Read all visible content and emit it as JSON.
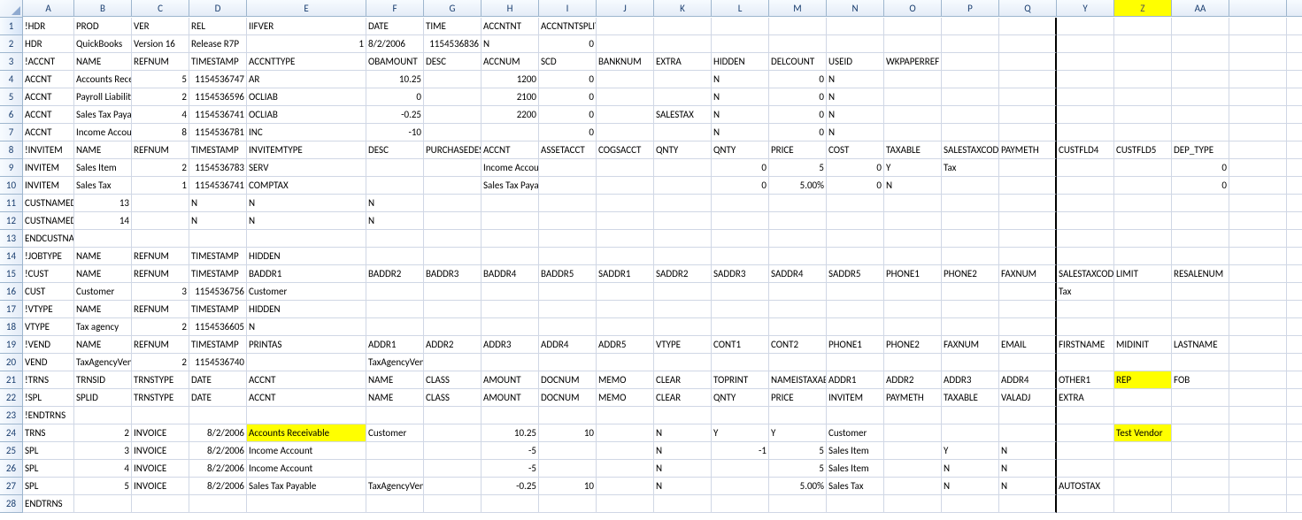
{
  "columns": [
    "",
    "A",
    "B",
    "C",
    "D",
    "E",
    "F",
    "G",
    "H",
    "I",
    "J",
    "K",
    "L",
    "M",
    "N",
    "O",
    "P",
    "Q",
    "Y",
    "Z",
    "AA"
  ],
  "highlight_col_index": 19,
  "thicksep_col_index": 17,
  "rows": [
    {
      "n": 1,
      "cells": [
        "!HDR",
        "PROD",
        "VER",
        "REL",
        "IIFVER",
        "DATE",
        "TIME",
        "ACCNTNT",
        "ACCNTNTSPLITTIME",
        "",
        "",
        "",
        "",
        "",
        "",
        "",
        "",
        "",
        "",
        ""
      ]
    },
    {
      "n": 2,
      "cells": [
        "HDR",
        "QuickBooks",
        "Version 16",
        "Release R7P",
        "1",
        "8/2/2006",
        "1154536836",
        "N",
        "0",
        "",
        "",
        "",
        "",
        "",
        "",
        "",
        "",
        "",
        "",
        ""
      ],
      "num": [
        4,
        6,
        8
      ]
    },
    {
      "n": 3,
      "cells": [
        "!ACCNT",
        "NAME",
        "REFNUM",
        "TIMESTAMP",
        "ACCNTTYPE",
        "OBAMOUNT",
        "DESC",
        "ACCNUM",
        "SCD",
        "BANKNUM",
        "EXTRA",
        "HIDDEN",
        "DELCOUNT",
        "USEID",
        "WKPAPERREF",
        "",
        "",
        "",
        "",
        ""
      ]
    },
    {
      "n": 4,
      "cells": [
        "ACCNT",
        "Accounts Receivable",
        "5",
        "1154536747",
        "AR",
        "10.25",
        "",
        "1200",
        "0",
        "",
        "",
        "N",
        "0",
        "N",
        "",
        "",
        "",
        "",
        "",
        ""
      ],
      "num": [
        2,
        3,
        5,
        7,
        8,
        12
      ]
    },
    {
      "n": 5,
      "cells": [
        "ACCNT",
        "Payroll Liabilities",
        "2",
        "1154536596",
        "OCLIAB",
        "0",
        "",
        "2100",
        "0",
        "",
        "",
        "N",
        "0",
        "N",
        "",
        "",
        "",
        "",
        "",
        ""
      ],
      "num": [
        2,
        3,
        5,
        7,
        8,
        12
      ]
    },
    {
      "n": 6,
      "cells": [
        "ACCNT",
        "Sales Tax Payable",
        "4",
        "1154536741",
        "OCLIAB",
        "-0.25",
        "",
        "2200",
        "0",
        "",
        "SALESTAX",
        "N",
        "0",
        "N",
        "",
        "",
        "",
        "",
        "",
        ""
      ],
      "num": [
        2,
        3,
        5,
        7,
        8,
        12
      ]
    },
    {
      "n": 7,
      "cells": [
        "ACCNT",
        "Income Account",
        "8",
        "1154536781",
        "INC",
        "-10",
        "",
        "",
        "0",
        "",
        "",
        "N",
        "0",
        "N",
        "",
        "",
        "",
        "",
        "",
        ""
      ],
      "num": [
        2,
        3,
        5,
        8,
        12
      ]
    },
    {
      "n": 8,
      "cells": [
        "!INVITEM",
        "NAME",
        "REFNUM",
        "TIMESTAMP",
        "INVITEMTYPE",
        "DESC",
        "PURCHASEDESC",
        "ACCNT",
        "ASSETACCT",
        "COGSACCT",
        "QNTY",
        "QNTY",
        "PRICE",
        "COST",
        "TAXABLE",
        "SALESTAXCODE",
        "PAYMETH",
        "CUSTFLD4",
        "CUSTFLD5",
        "DEP_TYPE"
      ]
    },
    {
      "n": 9,
      "cells": [
        "INVITEM",
        "Sales Item",
        "2",
        "1154536783",
        "SERV",
        "",
        "",
        "Income Account",
        "",
        "",
        "",
        "0",
        "5",
        "0",
        "Y",
        "Tax",
        "",
        "",
        "",
        "0"
      ],
      "num": [
        2,
        3,
        11,
        12,
        13,
        19
      ]
    },
    {
      "n": 10,
      "cells": [
        "INVITEM",
        "Sales Tax",
        "1",
        "1154536741",
        "COMPTAX",
        "",
        "",
        "Sales Tax Payable",
        "",
        "",
        "",
        "0",
        "5.00%",
        "0",
        "N",
        "",
        "",
        "",
        "",
        "0"
      ],
      "num": [
        2,
        3,
        11,
        12,
        13,
        19
      ]
    },
    {
      "n": 11,
      "cells": [
        "CUSTNAMEDICT",
        "13",
        "",
        "N",
        "N",
        "N",
        "",
        "",
        "",
        "",
        "",
        "",
        "",
        "",
        "",
        "",
        "",
        "",
        "",
        ""
      ],
      "num": [
        1
      ]
    },
    {
      "n": 12,
      "cells": [
        "CUSTNAMEDICT",
        "14",
        "",
        "N",
        "N",
        "N",
        "",
        "",
        "",
        "",
        "",
        "",
        "",
        "",
        "",
        "",
        "",
        "",
        "",
        ""
      ],
      "num": [
        1
      ]
    },
    {
      "n": 13,
      "cells": [
        "ENDCUSTNAMEDICT",
        "",
        "",
        "",
        "",
        "",
        "",
        "",
        "",
        "",
        "",
        "",
        "",
        "",
        "",
        "",
        "",
        "",
        "",
        ""
      ]
    },
    {
      "n": 14,
      "cells": [
        "!JOBTYPE",
        "NAME",
        "REFNUM",
        "TIMESTAMP",
        "HIDDEN",
        "",
        "",
        "",
        "",
        "",
        "",
        "",
        "",
        "",
        "",
        "",
        "",
        "",
        "",
        ""
      ]
    },
    {
      "n": 15,
      "cells": [
        "!CUST",
        "NAME",
        "REFNUM",
        "TIMESTAMP",
        "BADDR1",
        "BADDR2",
        "BADDR3",
        "BADDR4",
        "BADDR5",
        "SADDR1",
        "SADDR2",
        "SADDR3",
        "SADDR4",
        "SADDR5",
        "PHONE1",
        "PHONE2",
        "FAXNUM",
        "SALESTAXCODE",
        "LIMIT",
        "RESALENUM"
      ]
    },
    {
      "n": 16,
      "cells": [
        "CUST",
        "Customer",
        "3",
        "1154536756",
        "Customer",
        "",
        "",
        "",
        "",
        "",
        "",
        "",
        "",
        "",
        "",
        "",
        "",
        "Tax",
        "",
        ""
      ],
      "num": [
        2,
        3
      ]
    },
    {
      "n": 17,
      "cells": [
        "!VTYPE",
        "NAME",
        "REFNUM",
        "TIMESTAMP",
        "HIDDEN",
        "",
        "",
        "",
        "",
        "",
        "",
        "",
        "",
        "",
        "",
        "",
        "",
        "",
        "",
        ""
      ]
    },
    {
      "n": 18,
      "cells": [
        "VTYPE",
        "Tax agency",
        "2",
        "1154536605",
        "N",
        "",
        "",
        "",
        "",
        "",
        "",
        "",
        "",
        "",
        "",
        "",
        "",
        "",
        "",
        ""
      ],
      "num": [
        2,
        3
      ]
    },
    {
      "n": 19,
      "cells": [
        "!VEND",
        "NAME",
        "REFNUM",
        "TIMESTAMP",
        "PRINTAS",
        "ADDR1",
        "ADDR2",
        "ADDR3",
        "ADDR4",
        "ADDR5",
        "VTYPE",
        "CONT1",
        "CONT2",
        "PHONE1",
        "PHONE2",
        "FAXNUM",
        "EMAIL",
        "FIRSTNAME",
        "MIDINIT",
        "LASTNAME"
      ]
    },
    {
      "n": 20,
      "cells": [
        "VEND",
        "TaxAgencyVendor",
        "2",
        "1154536740",
        "",
        "TaxAgencyVendor",
        "",
        "",
        "",
        "",
        "",
        "",
        "",
        "",
        "",
        "",
        "",
        "",
        "",
        ""
      ],
      "num": [
        2,
        3
      ]
    },
    {
      "n": 21,
      "cells": [
        "!TRNS",
        "TRNSID",
        "TRNSTYPE",
        "DATE",
        "ACCNT",
        "NAME",
        "CLASS",
        "AMOUNT",
        "DOCNUM",
        "MEMO",
        "CLEAR",
        "TOPRINT",
        "NAMEISTAXABLE",
        "ADDR1",
        "ADDR2",
        "ADDR3",
        "ADDR4",
        "OTHER1",
        "REP",
        "FOB"
      ],
      "hl": [
        18
      ]
    },
    {
      "n": 22,
      "cells": [
        "!SPL",
        "SPLID",
        "TRNSTYPE",
        "DATE",
        "ACCNT",
        "NAME",
        "CLASS",
        "AMOUNT",
        "DOCNUM",
        "MEMO",
        "CLEAR",
        "QNTY",
        "PRICE",
        "INVITEM",
        "PAYMETH",
        "TAXABLE",
        "VALADJ",
        "EXTRA",
        "",
        ""
      ]
    },
    {
      "n": 23,
      "cells": [
        "!ENDTRNS",
        "",
        "",
        "",
        "",
        "",
        "",
        "",
        "",
        "",
        "",
        "",
        "",
        "",
        "",
        "",
        "",
        "",
        "",
        ""
      ]
    },
    {
      "n": 24,
      "cells": [
        "TRNS",
        "2",
        "INVOICE",
        "8/2/2006",
        "Accounts Receivable",
        "Customer",
        "",
        "10.25",
        "10",
        "",
        "N",
        "Y",
        "Y",
        "Customer",
        "",
        "",
        "",
        "",
        "Test Vendor",
        ""
      ],
      "num": [
        1,
        3,
        7,
        8
      ],
      "hl": [
        4,
        18
      ]
    },
    {
      "n": 25,
      "cells": [
        "SPL",
        "3",
        "INVOICE",
        "8/2/2006",
        "Income Account",
        "",
        "",
        "-5",
        "",
        "",
        "N",
        "-1",
        "5",
        "Sales Item",
        "",
        "Y",
        "N",
        "",
        "",
        ""
      ],
      "num": [
        1,
        3,
        7,
        11,
        12
      ]
    },
    {
      "n": 26,
      "cells": [
        "SPL",
        "4",
        "INVOICE",
        "8/2/2006",
        "Income Account",
        "",
        "",
        "-5",
        "",
        "",
        "N",
        "",
        "5",
        "Sales Item",
        "",
        "N",
        "N",
        "",
        "",
        ""
      ],
      "num": [
        1,
        3,
        7,
        12
      ]
    },
    {
      "n": 27,
      "cells": [
        "SPL",
        "5",
        "INVOICE",
        "8/2/2006",
        "Sales Tax Payable",
        "TaxAgencyVendor",
        "",
        "-0.25",
        "10",
        "",
        "N",
        "",
        "5.00%",
        "Sales Tax",
        "",
        "N",
        "N",
        "AUTOSTAX",
        "",
        ""
      ],
      "num": [
        1,
        3,
        7,
        8,
        12
      ]
    },
    {
      "n": 28,
      "cells": [
        "ENDTRNS",
        "",
        "",
        "",
        "",
        "",
        "",
        "",
        "",
        "",
        "",
        "",
        "",
        "",
        "",
        "",
        "",
        "",
        "",
        ""
      ]
    }
  ]
}
